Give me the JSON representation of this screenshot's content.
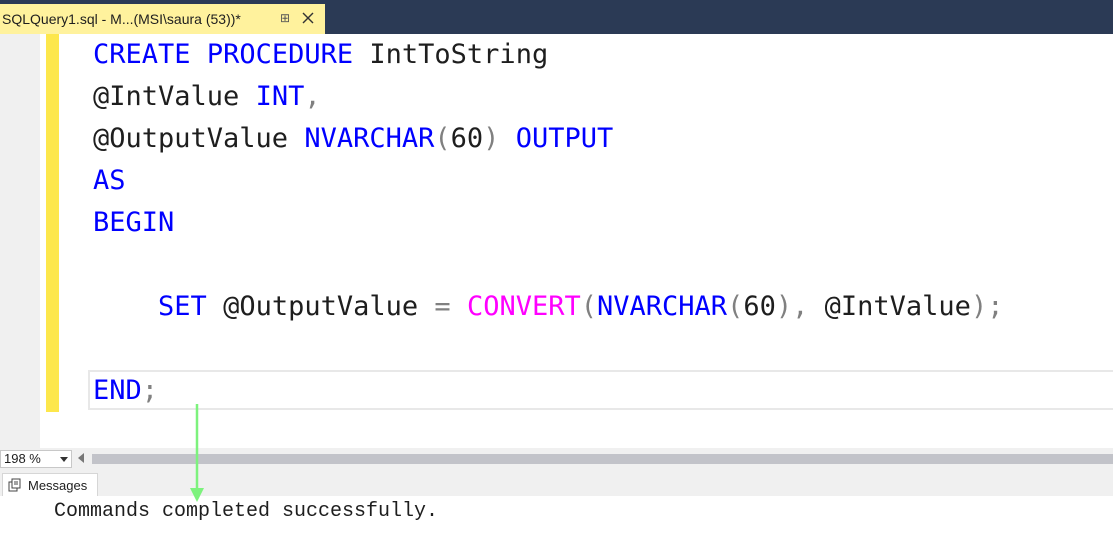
{
  "tab": {
    "title": "SQLQuery1.sql - M...(MSI\\saura (53))*",
    "pin_icon": "pin-icon",
    "close_icon": "close-icon"
  },
  "code": {
    "line1": {
      "kw1": "CREATE",
      "kw2": "PROCEDURE",
      "name": "IntToString"
    },
    "line2": {
      "param": "@IntValue",
      "type": "INT",
      "comma": ","
    },
    "line3": {
      "param": "@OutputValue",
      "type": "NVARCHAR",
      "open": "(",
      "size": "60",
      "close": ")",
      "kw": "OUTPUT"
    },
    "line4": {
      "kw": "AS"
    },
    "line5": {
      "kw": "BEGIN"
    },
    "line7": {
      "kw": "SET",
      "var": "@OutputValue",
      "eq": "=",
      "fn": "CONVERT",
      "open": "(",
      "type": "NVARCHAR",
      "open2": "(",
      "size": "60",
      "close2": ")",
      "comma": ",",
      "arg": "@IntValue",
      "close": ")",
      "semi": ";"
    },
    "line9": {
      "kw": "END",
      "semi": ";"
    }
  },
  "zoom": {
    "value": "198 %"
  },
  "results": {
    "tab_label": "Messages",
    "message": "Commands completed successfully."
  },
  "colors": {
    "tab_active": "#fff29d",
    "tab_bar": "#2b3a55",
    "keyword": "#0000ff",
    "function": "#ff00ff",
    "operator": "#808080",
    "change_bar": "#fde74c",
    "annotation_arrow": "#7df27d"
  }
}
